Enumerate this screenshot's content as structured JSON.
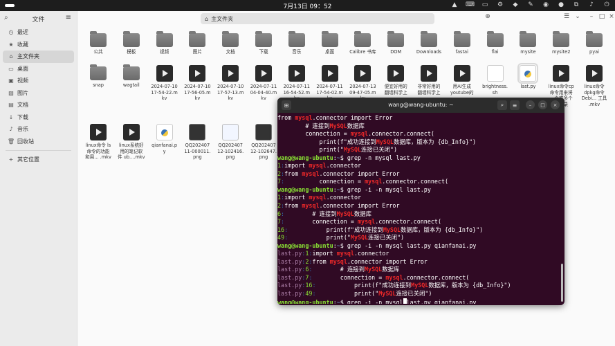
{
  "topbar": {
    "clock": "7月13日 09：52",
    "tray_icons": [
      "warning-icon",
      "keyboard-icon",
      "window-icon",
      "settings-icon",
      "vscode-icon",
      "paperclip-icon",
      "chrome-icon",
      "wechat-icon",
      "network-icon",
      "volume-icon",
      "power-icon"
    ]
  },
  "sidebar": {
    "title": "文件",
    "items": [
      {
        "label": "最近",
        "icon": "clock-icon"
      },
      {
        "label": "收藏",
        "icon": "star-icon"
      },
      {
        "label": "主文件夹",
        "icon": "home-icon"
      },
      {
        "label": "桌面",
        "icon": "desktop-icon"
      },
      {
        "label": "视频",
        "icon": "video-icon"
      },
      {
        "label": "图片",
        "icon": "image-icon"
      },
      {
        "label": "文档",
        "icon": "document-icon"
      },
      {
        "label": "下载",
        "icon": "download-icon"
      },
      {
        "label": "音乐",
        "icon": "music-icon"
      },
      {
        "label": "回收站",
        "icon": "trash-icon"
      }
    ],
    "other": {
      "label": "其它位置",
      "icon": "plus-icon"
    }
  },
  "pathbar": {
    "label": "主文件夹"
  },
  "files": [
    {
      "name": "公共",
      "type": "folder"
    },
    {
      "name": "模板",
      "type": "folder"
    },
    {
      "name": "视频",
      "type": "folder"
    },
    {
      "name": "图片",
      "type": "folder"
    },
    {
      "name": "文档",
      "type": "folder"
    },
    {
      "name": "下载",
      "type": "folder"
    },
    {
      "name": "音乐",
      "type": "folder"
    },
    {
      "name": "桌面",
      "type": "folder"
    },
    {
      "name": "Calibre 书库",
      "type": "folder"
    },
    {
      "name": "DOM",
      "type": "folder"
    },
    {
      "name": "Downloads",
      "type": "folder"
    },
    {
      "name": "fastai",
      "type": "folder"
    },
    {
      "name": "flai",
      "type": "folder"
    },
    {
      "name": "mysite",
      "type": "folder"
    },
    {
      "name": "mysite2",
      "type": "folder"
    },
    {
      "name": "pyai",
      "type": "folder"
    },
    {
      "name": "snap",
      "type": "folder"
    },
    {
      "name": "wagtail",
      "type": "folder"
    },
    {
      "name": "2024-07-10\n17-54-22.m\nkv",
      "type": "video"
    },
    {
      "name": "2024-07-10\n17-56-05.m\nkv",
      "type": "video"
    },
    {
      "name": "2024-07-10\n17-57-13.m\nkv",
      "type": "video"
    },
    {
      "name": "2024-07-11\n04-04-40.m\nkv",
      "type": "video"
    },
    {
      "name": "2024-07-11\n16-54-52.m\nkv",
      "type": "video"
    },
    {
      "name": "2024-07-11\n17-54-02.m\nkv",
      "type": "video"
    },
    {
      "name": "2024-07-13\n09-47-05.m\nkv",
      "type": "video"
    },
    {
      "name": "便宜好用的\n翻墙科学上",
      "type": "video"
    },
    {
      "name": "非常好用的\n翻墙科学上",
      "type": "video"
    },
    {
      "name": "用AI生成\nyoutube的",
      "type": "video"
    },
    {
      "name": "brightness.\nsh",
      "type": "doc"
    },
    {
      "name": "last.py",
      "type": "py"
    },
    {
      "name": "linux命令cp\n命令用来将\n一个或多个\n源目录",
      "type": "video"
    },
    {
      "name": "linux命令\ndpkg命令\nDebi... 工具\n.mkv",
      "type": "video"
    },
    {
      "name": "linux命令 ls\n命令的功能\n和用... .mkv",
      "type": "video"
    },
    {
      "name": "linux系统好\n用的笔记软\n件 ub....mkv",
      "type": "video"
    },
    {
      "name": "qianfanai.p\ny",
      "type": "py"
    },
    {
      "name": "QQ202407\n11-000011.\npng",
      "type": "img"
    },
    {
      "name": "QQ202407\n12-102416.\npng",
      "type": "img2"
    },
    {
      "name": "QQ202407\n12-102647.\npng",
      "type": "img"
    }
  ],
  "terminal": {
    "title": "wang@wang-ubuntu: ~",
    "colors": {
      "bg": "#300a24",
      "prompt": "#8ae234",
      "path": "#729fcf",
      "match": "#ef2929",
      "lineno": "#8ae234",
      "filename": "#ad7fa8",
      "sep": "#3465a4"
    },
    "lines": [
      [
        {
          "t": "from ",
          "c": "w"
        },
        {
          "t": "mysql",
          "c": "r"
        },
        {
          "t": ".connector import Error",
          "c": "w"
        }
      ],
      [
        {
          "t": "        # 连接到",
          "c": "w"
        },
        {
          "t": "MySQL",
          "c": "r"
        },
        {
          "t": "数据库",
          "c": "w"
        }
      ],
      [
        {
          "t": "        connection = ",
          "c": "w"
        },
        {
          "t": "mysql",
          "c": "r"
        },
        {
          "t": ".connector.connect(",
          "c": "w"
        }
      ],
      [
        {
          "t": "            print(f\"成功连接到",
          "c": "w"
        },
        {
          "t": "MySQL",
          "c": "r"
        },
        {
          "t": "数据库，版本为 {db_Info}\")",
          "c": "w"
        }
      ],
      [
        {
          "t": "            print(\"",
          "c": "w"
        },
        {
          "t": "MySQL",
          "c": "r"
        },
        {
          "t": "连接已关闭\")",
          "c": "w"
        }
      ],
      [
        {
          "t": "wang@wang-ubuntu",
          "c": "g"
        },
        {
          "t": ":",
          "c": "w"
        },
        {
          "t": "~",
          "c": "b"
        },
        {
          "t": "$ grep -n mysql last.py",
          "c": "w"
        }
      ],
      [
        {
          "t": "1",
          "c": "g"
        },
        {
          "t": ":",
          "c": "s"
        },
        {
          "t": "import ",
          "c": "w"
        },
        {
          "t": "mysql",
          "c": "r"
        },
        {
          "t": ".connector",
          "c": "w"
        }
      ],
      [
        {
          "t": "2",
          "c": "g"
        },
        {
          "t": ":",
          "c": "s"
        },
        {
          "t": "from ",
          "c": "w"
        },
        {
          "t": "mysql",
          "c": "r"
        },
        {
          "t": ".connector import Error",
          "c": "w"
        }
      ],
      [
        {
          "t": "7",
          "c": "g"
        },
        {
          "t": ":",
          "c": "s"
        },
        {
          "t": "          connection = ",
          "c": "w"
        },
        {
          "t": "mysql",
          "c": "r"
        },
        {
          "t": ".connector.connect(",
          "c": "w"
        }
      ],
      [
        {
          "t": "wang@wang-ubuntu",
          "c": "g"
        },
        {
          "t": ":",
          "c": "w"
        },
        {
          "t": "~",
          "c": "b"
        },
        {
          "t": "$ grep -i -n mysql last.py",
          "c": "w"
        }
      ],
      [
        {
          "t": "1",
          "c": "g"
        },
        {
          "t": ":",
          "c": "s"
        },
        {
          "t": "import ",
          "c": "w"
        },
        {
          "t": "mysql",
          "c": "r"
        },
        {
          "t": ".connector",
          "c": "w"
        }
      ],
      [
        {
          "t": "2",
          "c": "g"
        },
        {
          "t": ":",
          "c": "s"
        },
        {
          "t": "from ",
          "c": "w"
        },
        {
          "t": "mysql",
          "c": "r"
        },
        {
          "t": ".connector import Error",
          "c": "w"
        }
      ],
      [
        {
          "t": "6",
          "c": "g"
        },
        {
          "t": ":",
          "c": "s"
        },
        {
          "t": "        # 连接到",
          "c": "w"
        },
        {
          "t": "MySQL",
          "c": "r"
        },
        {
          "t": "数据库",
          "c": "w"
        }
      ],
      [
        {
          "t": "7",
          "c": "g"
        },
        {
          "t": ":",
          "c": "s"
        },
        {
          "t": "        connection = ",
          "c": "w"
        },
        {
          "t": "mysql",
          "c": "r"
        },
        {
          "t": ".connector.connect(",
          "c": "w"
        }
      ],
      [
        {
          "t": "16",
          "c": "g"
        },
        {
          "t": ":",
          "c": "s"
        },
        {
          "t": "           print(f\"成功连接到",
          "c": "w"
        },
        {
          "t": "MySQL",
          "c": "r"
        },
        {
          "t": "数据库，版本为 {db_Info}\")",
          "c": "w"
        }
      ],
      [
        {
          "t": "49",
          "c": "g"
        },
        {
          "t": ":",
          "c": "s"
        },
        {
          "t": "           print(\"",
          "c": "w"
        },
        {
          "t": "MySQL",
          "c": "r"
        },
        {
          "t": "连接已关闭\")",
          "c": "w"
        }
      ],
      [
        {
          "t": "wang@wang-ubuntu",
          "c": "g"
        },
        {
          "t": ":",
          "c": "w"
        },
        {
          "t": "~",
          "c": "b"
        },
        {
          "t": "$ grep -i -n mysql last.py qianfanai.py",
          "c": "w"
        }
      ],
      [
        {
          "t": "last.py",
          "c": "p"
        },
        {
          "t": ":",
          "c": "s"
        },
        {
          "t": "1",
          "c": "g"
        },
        {
          "t": ":",
          "c": "s"
        },
        {
          "t": "import ",
          "c": "w"
        },
        {
          "t": "mysql",
          "c": "r"
        },
        {
          "t": ".connector",
          "c": "w"
        }
      ],
      [
        {
          "t": "last.py",
          "c": "p"
        },
        {
          "t": ":",
          "c": "s"
        },
        {
          "t": "2",
          "c": "g"
        },
        {
          "t": ":",
          "c": "s"
        },
        {
          "t": "from ",
          "c": "w"
        },
        {
          "t": "mysql",
          "c": "r"
        },
        {
          "t": ".connector import Error",
          "c": "w"
        }
      ],
      [
        {
          "t": "last.py",
          "c": "p"
        },
        {
          "t": ":",
          "c": "s"
        },
        {
          "t": "6",
          "c": "g"
        },
        {
          "t": ":",
          "c": "s"
        },
        {
          "t": "        # 连接到",
          "c": "w"
        },
        {
          "t": "MySQL",
          "c": "r"
        },
        {
          "t": "数据库",
          "c": "w"
        }
      ],
      [
        {
          "t": "last.py",
          "c": "p"
        },
        {
          "t": ":",
          "c": "s"
        },
        {
          "t": "7",
          "c": "g"
        },
        {
          "t": ":",
          "c": "s"
        },
        {
          "t": "        connection = ",
          "c": "w"
        },
        {
          "t": "mysql",
          "c": "r"
        },
        {
          "t": ".connector.connect(",
          "c": "w"
        }
      ],
      [
        {
          "t": "last.py",
          "c": "p"
        },
        {
          "t": ":",
          "c": "s"
        },
        {
          "t": "16",
          "c": "g"
        },
        {
          "t": ":",
          "c": "s"
        },
        {
          "t": "           print(f\"成功连接到",
          "c": "w"
        },
        {
          "t": "MySQL",
          "c": "r"
        },
        {
          "t": "数据库，版本为 {db_Info}\")",
          "c": "w"
        }
      ],
      [
        {
          "t": "last.py",
          "c": "p"
        },
        {
          "t": ":",
          "c": "s"
        },
        {
          "t": "49",
          "c": "g"
        },
        {
          "t": ":",
          "c": "s"
        },
        {
          "t": "           print(\"",
          "c": "w"
        },
        {
          "t": "MySQL",
          "c": "r"
        },
        {
          "t": "连接已关闭\")",
          "c": "w"
        }
      ],
      [
        {
          "t": "wang@wang-ubuntu",
          "c": "g"
        },
        {
          "t": ":",
          "c": "w"
        },
        {
          "t": "~",
          "c": "b"
        },
        {
          "t": "$ grep -i -n mysql",
          "c": "w"
        },
        {
          "t": "",
          "c": "cursor"
        },
        {
          "t": "last.py qianfanai.py",
          "c": "w"
        }
      ]
    ]
  }
}
